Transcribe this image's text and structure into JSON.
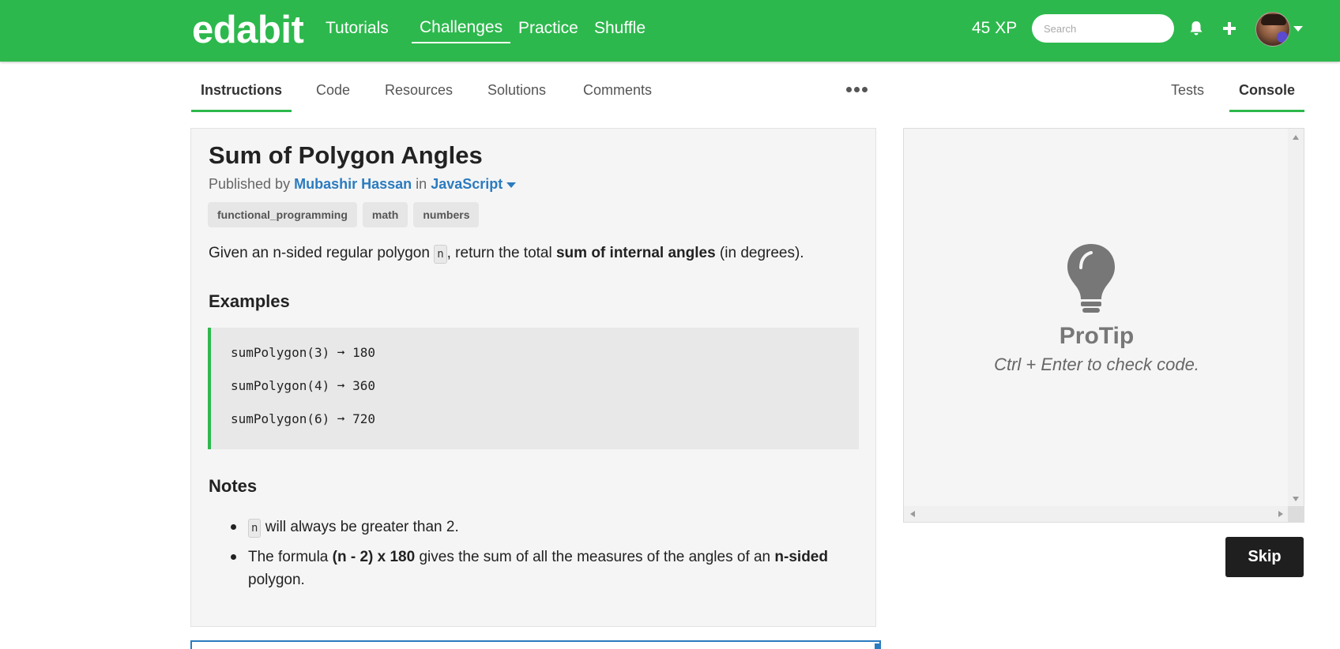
{
  "nav": {
    "logo": "edabit",
    "links": [
      "Tutorials",
      "Challenges",
      "Practice",
      "Shuffle"
    ],
    "active_link": "Challenges",
    "xp": "45 XP",
    "search_placeholder": "Search",
    "icons": [
      "bell-icon",
      "plus-icon",
      "avatar",
      "chevron-down-icon"
    ]
  },
  "tabs": {
    "left": [
      "Instructions",
      "Code",
      "Resources",
      "Solutions",
      "Comments"
    ],
    "right": [
      "Tests",
      "Console"
    ],
    "active_left": "Instructions",
    "active_right": "Console",
    "more_icon": "more-dots-icon"
  },
  "challenge": {
    "title": "Sum of Polygon Angles",
    "published_prefix": "Published by",
    "author": "Mubashir Hassan",
    "in_word": "in",
    "language": "JavaScript",
    "tags": [
      "functional_programming",
      "math",
      "numbers"
    ],
    "description": {
      "part1": "Given an n-sided regular polygon",
      "code": "n",
      "part2": ", return the total",
      "bold": "sum of internal angles",
      "part3": "(in degrees)."
    },
    "examples_heading": "Examples",
    "examples": [
      "sumPolygon(3) ➞ 180",
      "sumPolygon(4) ➞ 360",
      "sumPolygon(6) ➞ 720"
    ],
    "notes_heading": "Notes",
    "notes": {
      "note1": {
        "code": "n",
        "text": "will always be greater than 2."
      },
      "note2": {
        "part1": "The formula",
        "bold1": "(n - 2) x 180",
        "part2": "gives the sum of all the measures of the angles of an",
        "bold2": "n-sided",
        "part3": "polygon."
      }
    }
  },
  "console": {
    "protip_title": "ProTip",
    "protip_text": "Ctrl + Enter to check code.",
    "icon": "lightbulb-icon"
  },
  "actions": {
    "skip_label": "Skip"
  },
  "colors": {
    "brand_green": "#2db84d",
    "link_blue": "#2b7bbf",
    "skip_button": "#1f1f1f"
  }
}
